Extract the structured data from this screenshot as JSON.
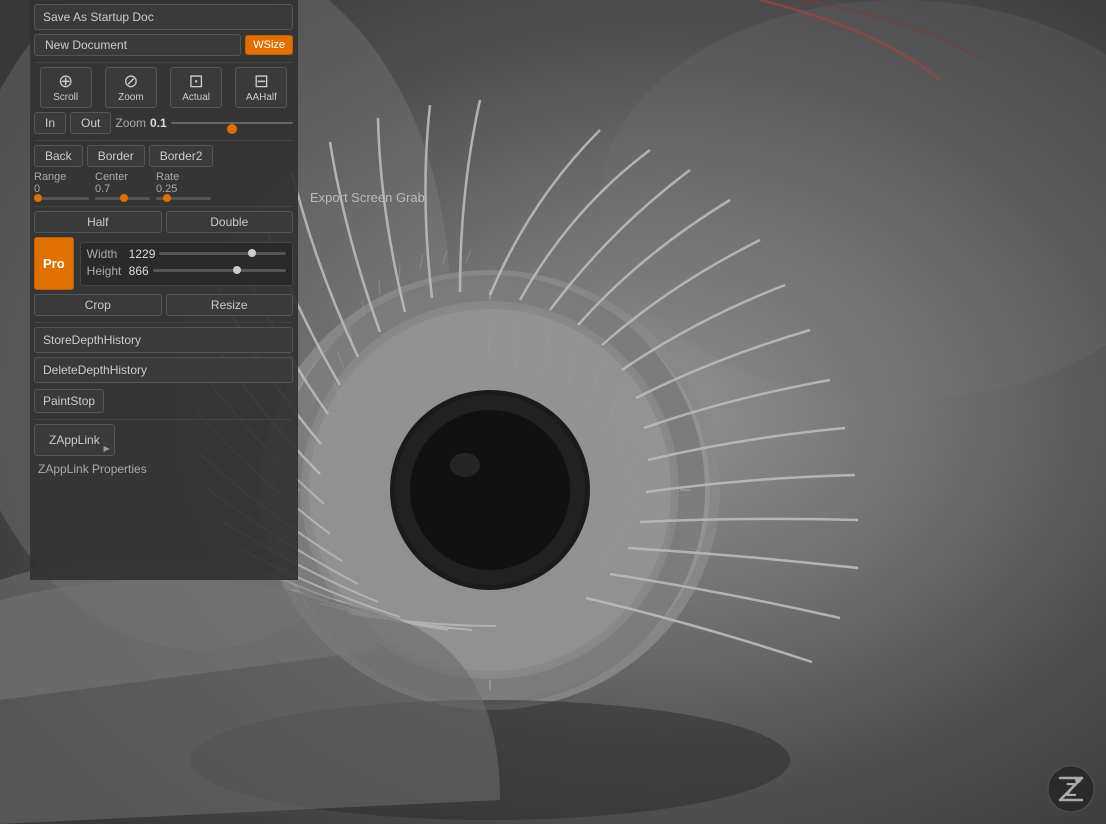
{
  "sidebar": {
    "save_as_startup": "Save As Startup Doc",
    "new_document": "New Document",
    "wsize": "WSize",
    "scroll_label": "Scroll",
    "zoom_btn_label": "Zoom",
    "actual_label": "Actual",
    "aahalf_label": "AAHalf",
    "in_label": "In",
    "out_label": "Out",
    "zoom_label": "Zoom",
    "zoom_value": "0.1",
    "back_label": "Back",
    "border_label": "Border",
    "border2_label": "Border2",
    "range_label": "Range",
    "range_value": "0",
    "center_label": "Center",
    "center_value": "0.7",
    "rate_label": "Rate",
    "rate_value": "0.25",
    "half_label": "Half",
    "double_label": "Double",
    "pro_label": "Pro",
    "width_label": "Width",
    "width_value": "1229",
    "height_label": "Height",
    "height_value": "866",
    "crop_label": "Crop",
    "resize_label": "Resize",
    "store_depth": "StoreDepthHistory",
    "delete_depth": "DeleteDepthHistory",
    "paint_stop": "PaintStop",
    "zapplink_label": "ZAppLink",
    "zapplink_props": "ZAppLink Properties"
  },
  "canvas": {
    "export_label": "Export Screen Grab"
  },
  "icons": {
    "scroll": "⊕",
    "zoom": "⊘",
    "actual": "⊡",
    "aahalf": "⊟"
  }
}
